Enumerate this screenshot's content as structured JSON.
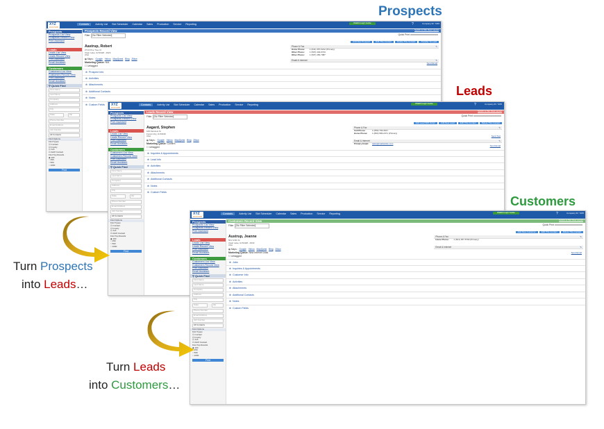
{
  "captions": {
    "prospects": "Prospects",
    "leads": "Leads",
    "customers": "Customers"
  },
  "narration": {
    "line1_a": "Turn ",
    "line1_b": "Prospects",
    "line2_a": "into ",
    "line2_b": "Leads",
    "line2_c": "…",
    "line3_a": "Turn ",
    "line3_b": "Leads",
    "line4_a": "into ",
    "line4_b": "Customers",
    "line4_c": "…"
  },
  "app": {
    "logo": "XYZ",
    "logo_sub": "EXACOMM",
    "nav": [
      "Contacts",
      "Activity List",
      "Slot Scheduler",
      "Calendar",
      "Sales",
      "Production",
      "Service",
      "Reporting"
    ],
    "walkthrough": "Walkthrough Guide",
    "company": "Company ID: 7245",
    "help": "?",
    "quick_find": "Quick Find",
    "find_fields": [
      "First Name",
      "Last Name",
      "Company",
      "Address",
      "City",
      "State",
      "Zip",
      "Phone Number",
      "Email Address",
      "Job Number"
    ],
    "all_contacts": "All Contacts",
    "find_options": "Find Options",
    "find_types_label": "Find Types",
    "find_types": [
      "Contact",
      "Inquiry",
      "Job",
      "Add'l Contact"
    ],
    "find_top_label": "Find Top Results",
    "find_top": [
      "100",
      "250",
      "500",
      "1000"
    ],
    "find_button": "Find",
    "filter_label": "Filter",
    "filter_value": "[No Filter Selected]",
    "quick_print": "Quick Print",
    "switch_link": "Switch to Tab View Layout",
    "maps_label": "Maps:",
    "maps": [
      "Google",
      "Yahoo",
      "MapQuest",
      "Bing",
      "Zillow"
    ],
    "marketing_label": "Marketing Queue:",
    "untagged": "Untagged",
    "phone_fax": "Phone & Fax",
    "email_internet": "Email & Internet",
    "send_email": "Send Email"
  },
  "sidebar": {
    "prospects": {
      "title": "Prospects",
      "links": [
        "Prospects List View",
        "Prospects Record View",
        "Print Assistant"
      ]
    },
    "leads": {
      "title": "Leads",
      "links": [
        "Leads List View",
        "Leads Record View",
        "Print Assistant",
        "Email Assistant"
      ]
    },
    "customers": {
      "title": "Customers",
      "links": [
        "Customers List View",
        "Customers Record View",
        "Print Assistant",
        "Email Assistant"
      ]
    }
  },
  "prospect_view": {
    "title": "Prospects Record View",
    "buttons": [
      "Add New Prospect",
      "Edit This Contact",
      "Delete This Contact",
      "Transfer To Lead"
    ],
    "name": "Aastrup, Robert",
    "address": [
      "2713 Pine Tree Ct",
      "Clear Lake, IA 50428 - 2923",
      "USA"
    ],
    "marketing": "N/A",
    "phones": [
      {
        "k": "Home Phone:",
        "v": "1 (641) 357-5212 (Primary)"
      },
      {
        "k": "Other Phone:",
        "v": "1 (515) 404-9743"
      },
      {
        "k": "Other Phone:",
        "v": "1 (507) 456-7987"
      }
    ],
    "sections": [
      "Prospect Info",
      "Activities",
      "Attachments",
      "Additional Contacts",
      "Notes",
      "Custom Fields"
    ]
  },
  "lead_view": {
    "title": "Leads Record View",
    "buttons": [
      "Add Lead With Script",
      "Add New Lead",
      "Edit This Contact",
      "Delete This Contact"
    ],
    "name": "Aagard, Stephen",
    "address": [
      "106 Fairview St",
      "Forest City, IA 50436",
      "USA"
    ],
    "marketing": "Confirm",
    "phones": [
      {
        "k": "Cell Phone:",
        "v": "1 (650) 793-3917"
      },
      {
        "k": "Home Phone:",
        "v": "1 (800) 583-2371 (Primary)"
      }
    ],
    "email_key": "Primary Email:",
    "email": "sales@marketsite.com",
    "send_text": "Send Text",
    "sections": [
      "Inquiries & Appointments",
      "Lead Info",
      "Activities",
      "Attachments",
      "Additional Contacts",
      "Notes",
      "Custom Fields"
    ]
  },
  "customer_view": {
    "title": "Customers Record View",
    "buttons": [
      "Add New Customer",
      "Edit This Contact",
      "Delete This Contact"
    ],
    "name": "Austrup, Jeanne",
    "address": [
      "501 S 8th St",
      "Clear Lake, IA 50428 - 2533",
      "USA"
    ],
    "marketing": "New Internet Lead",
    "phones": [
      {
        "k": "Home Phone:",
        "v": "1 (641) 357-5793 (Primary)"
      }
    ],
    "sections": [
      "Jobs",
      "Inquiries & Appointments",
      "Customer Info",
      "Activities",
      "Attachments",
      "Additional Contacts",
      "Notes",
      "Custom Fields"
    ]
  }
}
